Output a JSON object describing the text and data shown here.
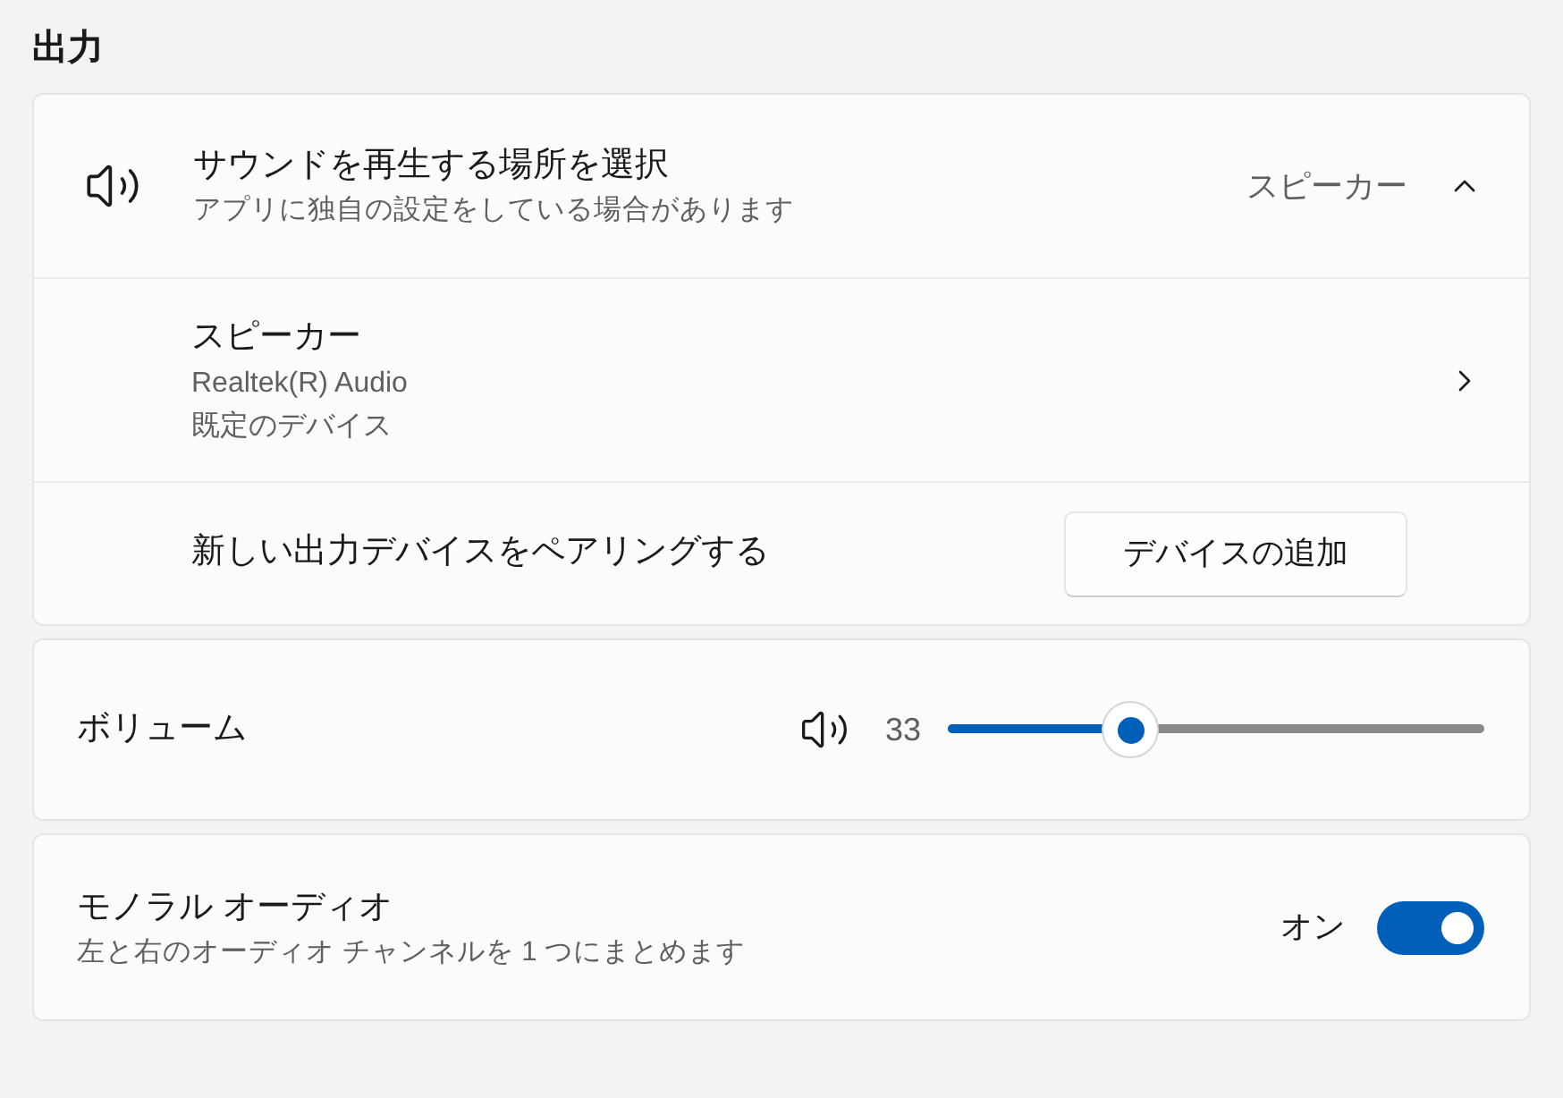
{
  "section_title": "出力",
  "output_card": {
    "header": {
      "title": "サウンドを再生する場所を選択",
      "subtitle": "アプリに独自の設定をしている場合があります",
      "value": "スピーカー",
      "expanded": true
    },
    "devices": [
      {
        "name": "スピーカー",
        "lines": [
          "Realtek(R) Audio",
          "既定のデバイス"
        ]
      }
    ],
    "pair_row": {
      "label": "新しい出力デバイスをペアリングする",
      "button": "デバイスの追加"
    }
  },
  "volume": {
    "label": "ボリューム",
    "reading": "33",
    "level": 0.34
  },
  "mono_audio": {
    "title": "モノラル オーディオ",
    "subtitle": "左と右のオーディオ チャンネルを 1 つにまとめます",
    "state_label": "オン",
    "on": true
  }
}
